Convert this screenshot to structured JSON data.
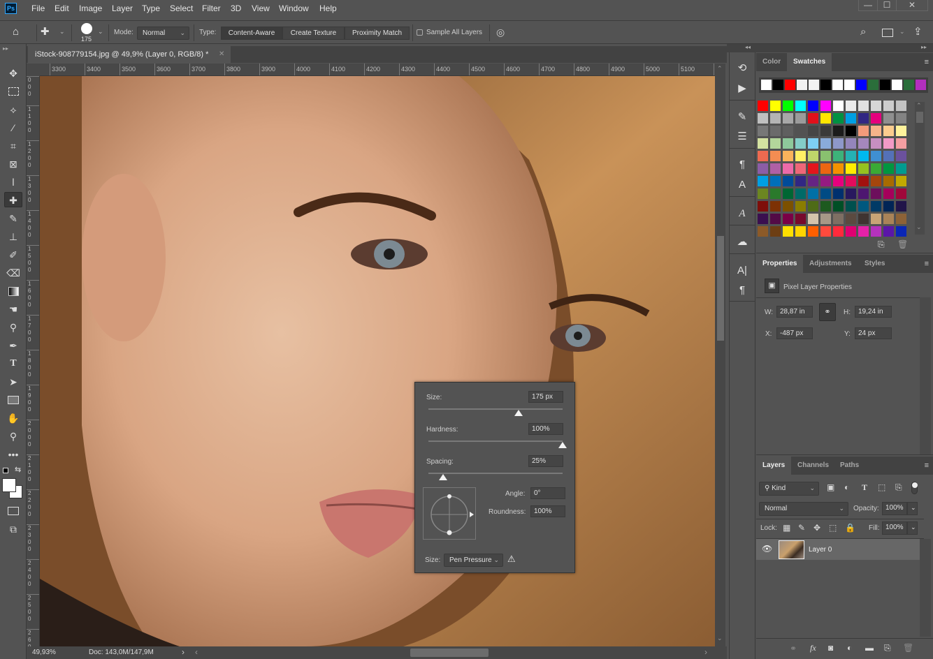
{
  "app": {
    "logo": "Ps"
  },
  "menu": [
    "File",
    "Edit",
    "Image",
    "Layer",
    "Type",
    "Select",
    "Filter",
    "3D",
    "View",
    "Window",
    "Help"
  ],
  "window_controls": {
    "minimize": "—",
    "maximize": "☐",
    "close": "✕"
  },
  "options_bar": {
    "brush_size": "175",
    "mode_label": "Mode:",
    "mode_value": "Normal",
    "type_label": "Type:",
    "type_options": [
      "Content-Aware",
      "Create Texture",
      "Proximity Match"
    ],
    "type_selected": "Content-Aware",
    "sample_all_layers_label": "Sample All Layers",
    "sample_all_layers_checked": false
  },
  "document": {
    "tab_title": "iStock-908779154.jpg @ 49,9% (Layer 0, RGB/8) *",
    "close": "✕",
    "h_ruler": [
      "3300",
      "3400",
      "3500",
      "3600",
      "3700",
      "3800",
      "3900",
      "4000",
      "4100",
      "4200",
      "4300",
      "4400",
      "4500",
      "4600",
      "4700",
      "4800",
      "4900",
      "5000",
      "5100",
      "5"
    ],
    "v_ruler": [
      "0\n0\n0",
      "1\n1\n0\n0",
      "1\n2\n0\n0",
      "1\n3\n0\n0",
      "1\n4\n0\n0",
      "1\n5\n0\n0",
      "1\n6\n0\n0",
      "1\n7\n0\n0",
      "1\n8\n0\n0",
      "1\n9\n0\n0",
      "2\n0\n0\n0",
      "2\n1\n0\n0",
      "2\n2\n0\n0",
      "2\n3\n0\n0",
      "2\n4\n0\n0",
      "2\n5\n0\n0",
      "2\n6\n0"
    ]
  },
  "status": {
    "zoom": "49,93%",
    "doc": "Doc: 143,0M/147,9M"
  },
  "tools": [
    "move",
    "rectangular-marquee",
    "polygonal-lasso",
    "magic-wand",
    "crop",
    "frame",
    "eyedropper",
    "spot-healing-brush",
    "brush",
    "clone-stamp",
    "history-brush",
    "eraser",
    "gradient",
    "smudge",
    "dodge",
    "pen",
    "type",
    "path-selection",
    "rectangle",
    "hand",
    "zoom",
    "edit-toolbar"
  ],
  "active_tool": "spot-healing-brush",
  "brush_popup": {
    "size_label": "Size:",
    "size_value": "175 px",
    "size_fraction": 0.67,
    "hardness_label": "Hardness:",
    "hardness_value": "100%",
    "hardness_fraction": 1.0,
    "spacing_label": "Spacing:",
    "spacing_value": "25%",
    "spacing_fraction": 0.11,
    "angle_label": "Angle:",
    "angle_value": "0°",
    "roundness_label": "Roundness:",
    "roundness_value": "100%",
    "size_control_label": "Size:",
    "size_control_value": "Pen Pressure"
  },
  "swatches_panel": {
    "tabs": [
      "Color",
      "Swatches"
    ],
    "active_tab": "Swatches",
    "recent": [
      "#ffffff",
      "#000000",
      "#ff0000",
      "#f2f2f2",
      "#f2f2f2",
      "#000000",
      "#ffffff",
      "#ffffff",
      "#0000ff",
      "#2a6e3a",
      "#000000",
      "#ffffff",
      "#2a6e3a",
      "#b22fbe"
    ],
    "grid": [
      [
        "#ff0000",
        "#ffff00",
        "#00ff00",
        "#00ffff",
        "#0000ff",
        "#ff00ff",
        "#ffffff",
        "#ebebeb",
        "#e1e1e1",
        "#d7d7d7",
        "#cdcdcd",
        "#c3c3c3"
      ],
      [
        "#c0c0c0",
        "#b4b4b4",
        "#a8a8a8",
        "#9b9b9b",
        "#e2101b",
        "#ffe600",
        "#009142",
        "#009fe3",
        "#312783",
        "#e5007d",
        "#8f8f8f",
        "#838383"
      ],
      [
        "#777777",
        "#6b6b6b",
        "#5f5f5f",
        "#525252",
        "#464646",
        "#3a3a3a",
        "#1c1c1c",
        "#000000",
        "#f29a7a",
        "#f6b48a",
        "#fbcc8e",
        "#fff29c"
      ],
      [
        "#d4e2a1",
        "#b3d69b",
        "#8ec99b",
        "#84cdc8",
        "#7ecff4",
        "#89abda",
        "#8e98ca",
        "#9485bb",
        "#a587bc",
        "#c78fc1",
        "#f29ac6",
        "#f49ea2"
      ],
      [
        "#ee6a50",
        "#f48d52",
        "#fab35b",
        "#fff065",
        "#bed66a",
        "#89c16f",
        "#3db27a",
        "#25b1b3",
        "#00b9ef",
        "#3f8fd2",
        "#5471b8",
        "#6b519d"
      ],
      [
        "#8b5da6",
        "#b060a5",
        "#ed6aa9",
        "#ee6778",
        "#e3161c",
        "#ec6611",
        "#f39200",
        "#ffec00",
        "#95c11f",
        "#3aaa35",
        "#009640",
        "#009b90"
      ],
      [
        "#009fe3",
        "#006fba",
        "#004b99",
        "#312783",
        "#662483",
        "#951b81",
        "#e6007e",
        "#e30b5c",
        "#a2110f",
        "#a5460d",
        "#a86b00",
        "#c1a900"
      ],
      [
        "#6c8621",
        "#2a7a2b",
        "#006633",
        "#006a67",
        "#0070a6",
        "#004b84",
        "#00306e",
        "#28185e",
        "#4d1670",
        "#6d0f5c",
        "#a6005b",
        "#a0073a"
      ],
      [
        "#7e0e0a",
        "#7d3104",
        "#7c5000",
        "#8a7d00",
        "#4e6b17",
        "#1d5a1f",
        "#004f26",
        "#00504e",
        "#00587f",
        "#003a66",
        "#002556",
        "#211549"
      ],
      [
        "#3a0f4f",
        "#530b46",
        "#7a0046",
        "#77092c",
        "#d4c4ac",
        "#a79887",
        "#7e6f63",
        "#5b4a40",
        "#3f3431",
        "#c8a476",
        "#a98358",
        "#8d6237"
      ],
      [
        "#8c5a28",
        "#6d3e13",
        "#ffe000",
        "#ffd400",
        "#ff5f00",
        "#ff4a3d",
        "#ff2a3c",
        "#de0071",
        "#e621a8",
        "#b532bd",
        "#5b16a8",
        "#0a26b6"
      ]
    ]
  },
  "properties_panel": {
    "tabs": [
      "Properties",
      "Adjustments",
      "Styles"
    ],
    "active_tab": "Properties",
    "title": "Pixel Layer Properties",
    "w_label": "W:",
    "w_value": "28,87 in",
    "h_label": "H:",
    "h_value": "19,24 in",
    "x_label": "X:",
    "x_value": "-487 px",
    "y_label": "Y:",
    "y_value": "24 px"
  },
  "layers_panel": {
    "tabs": [
      "Layers",
      "Channels",
      "Paths"
    ],
    "active_tab": "Layers",
    "filter_kind": "Kind",
    "blend_mode": "Normal",
    "opacity_label": "Opacity:",
    "opacity_value": "100%",
    "lock_label": "Lock:",
    "fill_label": "Fill:",
    "fill_value": "100%",
    "layers": [
      {
        "name": "Layer 0",
        "visible": true,
        "selected": true
      }
    ]
  },
  "colors": {
    "ui_bg": "#535353",
    "panel_dark": "#424242",
    "ps_blue": "#31a8ff"
  }
}
